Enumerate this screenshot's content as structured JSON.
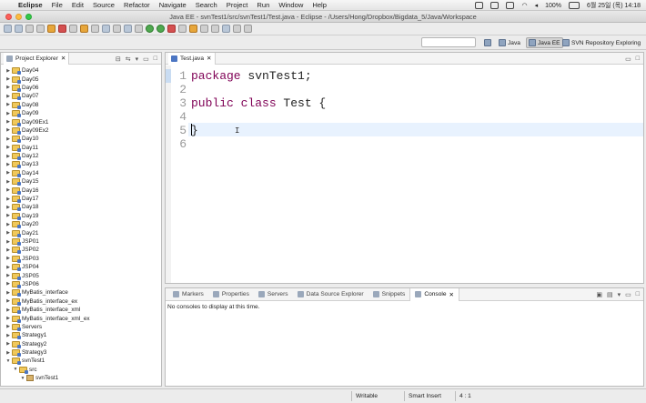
{
  "menubar": {
    "app": "Eclipse",
    "items": [
      "File",
      "Edit",
      "Source",
      "Refactor",
      "Navigate",
      "Search",
      "Project",
      "Run",
      "Window",
      "Help"
    ],
    "battery": "100%",
    "datetime": "6월 25일 (목)  14:18"
  },
  "window": {
    "title": "Java EE - svnTest1/src/svnTest1/Test.java - Eclipse - /Users/Hong/Dropbox/Bigdata_5/Java/Workspace"
  },
  "perspectives": [
    {
      "label": "Java",
      "active": false
    },
    {
      "label": "Java EE",
      "active": true
    },
    {
      "label": "SVN Repository Exploring",
      "active": false
    }
  ],
  "explorer": {
    "title": "Project Explorer",
    "items": [
      {
        "label": "Day04",
        "depth": 0,
        "expanded": false
      },
      {
        "label": "Day05",
        "depth": 0,
        "expanded": false
      },
      {
        "label": "Day06",
        "depth": 0,
        "expanded": false
      },
      {
        "label": "Day07",
        "depth": 0,
        "expanded": false
      },
      {
        "label": "Day08",
        "depth": 0,
        "expanded": false
      },
      {
        "label": "Day09",
        "depth": 0,
        "expanded": false
      },
      {
        "label": "Day09Ex1",
        "depth": 0,
        "expanded": false
      },
      {
        "label": "Day09Ex2",
        "depth": 0,
        "expanded": false
      },
      {
        "label": "Day10",
        "depth": 0,
        "expanded": false
      },
      {
        "label": "Day11",
        "depth": 0,
        "expanded": false
      },
      {
        "label": "Day12",
        "depth": 0,
        "expanded": false
      },
      {
        "label": "Day13",
        "depth": 0,
        "expanded": false
      },
      {
        "label": "Day14",
        "depth": 0,
        "expanded": false
      },
      {
        "label": "Day15",
        "depth": 0,
        "expanded": false
      },
      {
        "label": "Day16",
        "depth": 0,
        "expanded": false
      },
      {
        "label": "Day17",
        "depth": 0,
        "expanded": false
      },
      {
        "label": "Day18",
        "depth": 0,
        "expanded": false
      },
      {
        "label": "Day19",
        "depth": 0,
        "expanded": false
      },
      {
        "label": "Day20",
        "depth": 0,
        "expanded": false
      },
      {
        "label": "Day21",
        "depth": 0,
        "expanded": false
      },
      {
        "label": "JSP01",
        "depth": 0,
        "expanded": false
      },
      {
        "label": "JSP02",
        "depth": 0,
        "expanded": false
      },
      {
        "label": "JSP03",
        "depth": 0,
        "expanded": false
      },
      {
        "label": "JSP04",
        "depth": 0,
        "expanded": false
      },
      {
        "label": "JSP05",
        "depth": 0,
        "expanded": false
      },
      {
        "label": "JSP06",
        "depth": 0,
        "expanded": false
      },
      {
        "label": "MyBatis_interface",
        "depth": 0,
        "expanded": false
      },
      {
        "label": "MyBatis_interface_ex",
        "depth": 0,
        "expanded": false
      },
      {
        "label": "MyBatis_interface_xml",
        "depth": 0,
        "expanded": false
      },
      {
        "label": "MyBatis_interface_xml_ex",
        "depth": 0,
        "expanded": false
      },
      {
        "label": "Servers",
        "depth": 0,
        "expanded": false
      },
      {
        "label": "Strategy1",
        "depth": 0,
        "expanded": false
      },
      {
        "label": "Strategy2",
        "depth": 0,
        "expanded": false
      },
      {
        "label": "Strategy3",
        "depth": 0,
        "expanded": false
      },
      {
        "label": "svnTest1",
        "depth": 0,
        "expanded": true
      },
      {
        "label": "src",
        "depth": 1,
        "expanded": true
      },
      {
        "label": "svnTest1",
        "depth": 2,
        "expanded": true
      }
    ]
  },
  "editor": {
    "tab_label": "Test.java",
    "line_numbers": [
      "1",
      "2",
      "3",
      "4",
      "5",
      "6"
    ],
    "lines": [
      {
        "kw": "package",
        "rest": " svnTest1;"
      },
      {
        "kw": "",
        "rest": ""
      },
      {
        "kw": "public class",
        "rest": " Test {"
      },
      {
        "kw": "",
        "rest": ""
      },
      {
        "kw": "",
        "rest": "}"
      },
      {
        "kw": "",
        "rest": ""
      }
    ]
  },
  "console": {
    "tabs": [
      {
        "label": "Markers",
        "active": false
      },
      {
        "label": "Properties",
        "active": false
      },
      {
        "label": "Servers",
        "active": false
      },
      {
        "label": "Data Source Explorer",
        "active": false
      },
      {
        "label": "Snippets",
        "active": false
      },
      {
        "label": "Console",
        "active": true
      }
    ],
    "message": "No consoles to display at this time."
  },
  "status": {
    "writable": "Writable",
    "insert_mode": "Smart Insert",
    "position": "4 : 1"
  }
}
